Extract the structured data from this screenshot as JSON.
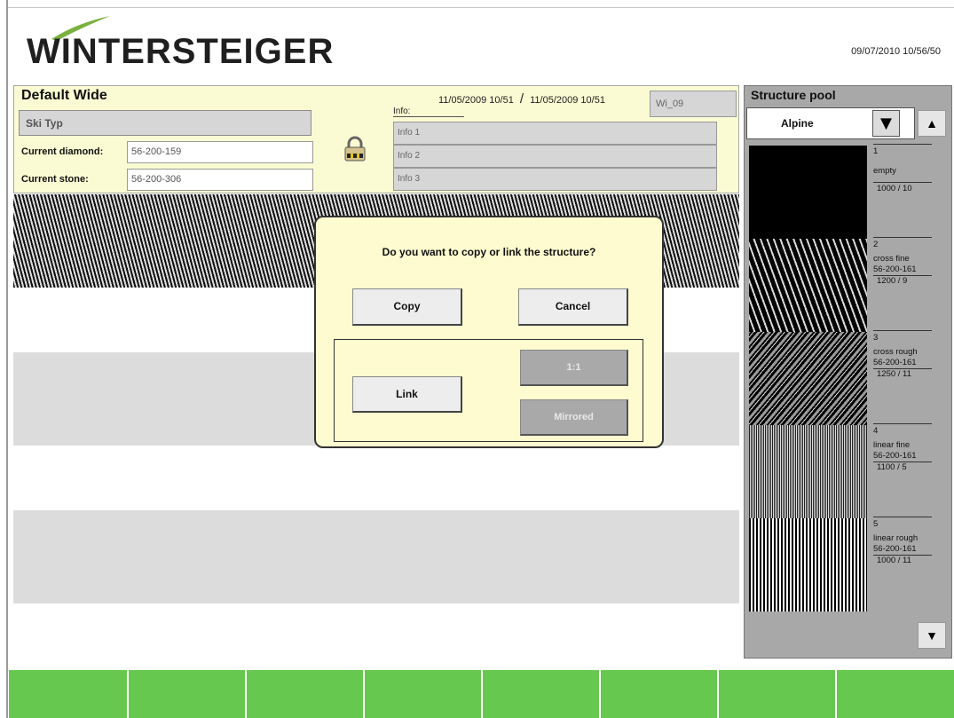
{
  "brand": {
    "name": "WINTERSTEIGER"
  },
  "datetime": "09/07/2010 10/56/50",
  "header": {
    "title": "Default Wide",
    "ski_type": "Ski Typ",
    "current_diamond_label": "Current diamond:",
    "current_diamond": "56-200-159",
    "current_stone_label": "Current stone:",
    "current_stone": "56-200-306",
    "date_from": "11/05/2009 10/51",
    "date_separator": "/",
    "date_to": "11/05/2009 10/51",
    "code": "Wi_09",
    "info_label": "Info:",
    "info": [
      "Info 1",
      "Info 2",
      "Info 3"
    ],
    "lock_icon": "padlock-icon"
  },
  "structure_pool": {
    "title": "Structure pool",
    "category": "Alpine",
    "items": [
      {
        "number": "1",
        "name": "empty",
        "code": "",
        "value": "1000 / 10"
      },
      {
        "number": "2",
        "name": "cross fine",
        "code": "56-200-161",
        "value": "1200 / 9"
      },
      {
        "number": "3",
        "name": "cross rough",
        "code": "56-200-161",
        "value": "1250 / 11"
      },
      {
        "number": "4",
        "name": "linear fine",
        "code": "56-200-161",
        "value": "1100 / 5"
      },
      {
        "number": "5",
        "name": "linear rough",
        "code": "56-200-161",
        "value": "1000 / 11"
      }
    ],
    "scroll_up_icon": "▲",
    "scroll_down_icon": "▼",
    "dropdown_icon": "▼"
  },
  "dialog": {
    "question": "Do you want to copy or link the structure?",
    "copy_label": "Copy",
    "cancel_label": "Cancel",
    "link_label": "Link",
    "one_to_one_label": "1:1",
    "mirrored_label": "Mirrored"
  },
  "colors": {
    "header_bg": "#fbfbd3",
    "bottom_bar": "#66c84e",
    "logo_accent": "#7ab040"
  }
}
